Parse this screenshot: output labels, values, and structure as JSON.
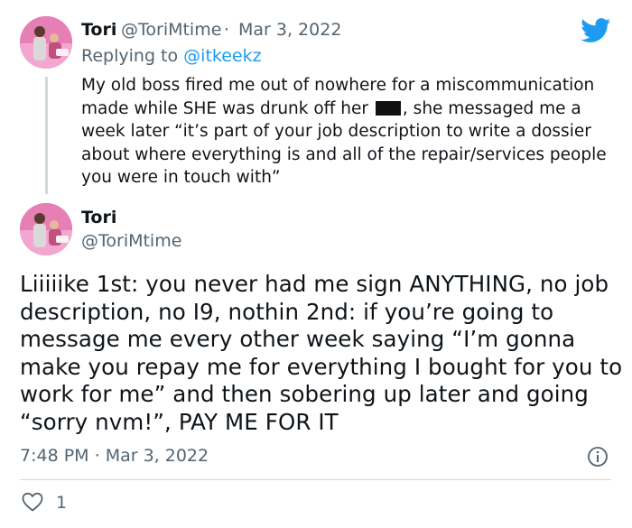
{
  "reply_tweet": {
    "name": "Tori",
    "handle": "@ToriMtime",
    "separator": "·",
    "date": "Mar 3, 2022",
    "replying_prefix": "Replying to",
    "replying_handle": "@itkeekz",
    "text_before_redaction": "My old boss fired me out of nowhere for a miscommunication made while SHE was drunk off her",
    "text_after_redaction": ", she messaged me a week later “it’s part of your job description to write a dossier about where everything is and all of the repair/services people you were in touch with”"
  },
  "main_tweet": {
    "name": "Tori",
    "handle": "@ToriMtime",
    "text": "Liiiiike 1st: you never had me sign ANYTHING, no job description, no I9, nothin 2nd: if you’re going to message me every other week saying “I’m gonna make you repay me for everything I bought for you to work for me” and then sobering up later and going “sorry nvm!”, PAY ME FOR IT",
    "time": "7:48 PM",
    "separator": "·",
    "date": "Mar 3, 2022",
    "like_count": "1"
  },
  "colors": {
    "twitter_blue": "#1d9bf0",
    "secondary_text": "#536471",
    "divider": "#cfd9de"
  },
  "icons": {
    "brand": "twitter-bird-icon",
    "info": "info-icon",
    "like": "heart-icon"
  }
}
